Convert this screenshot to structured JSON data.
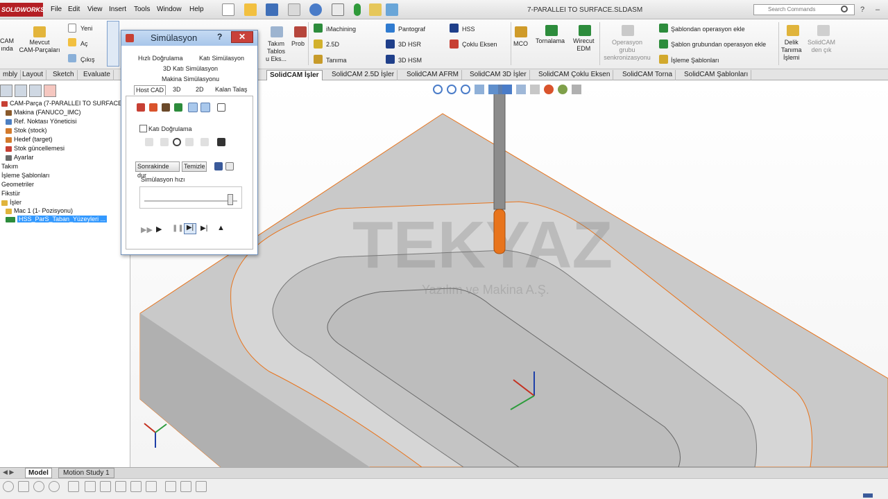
{
  "app": {
    "logo": "SOLIDWORKS",
    "document_title": "7-PARALLEI TO SURFACE.SLDASM",
    "search_placeholder": "Search Commands",
    "colors": {
      "accent": "#b41f24",
      "selection": "#3399ff",
      "tool_tip": "#e8741c"
    }
  },
  "menu": [
    "File",
    "Edit",
    "View",
    "Insert",
    "Tools",
    "Window",
    "Help"
  ],
  "ribbon": {
    "buttons": [
      {
        "label": "CAM\nında"
      },
      {
        "label": "Mevcut\nCAM-Parçaları"
      },
      {
        "label": "Yeni"
      },
      {
        "label": "Aç"
      },
      {
        "label": "Çıkış"
      },
      {
        "label": "Takım\nTablos\nu Eks..."
      },
      {
        "label": "Prob"
      },
      {
        "label": "iMachining"
      },
      {
        "label": "2.5D"
      },
      {
        "label": "Tanıma"
      },
      {
        "label": "Pantograf"
      },
      {
        "label": "3D HSR"
      },
      {
        "label": "3D HSM"
      },
      {
        "label": "HSS"
      },
      {
        "label": "Çoklu Eksen"
      },
      {
        "label": "MCO"
      },
      {
        "label": "Tornalama"
      },
      {
        "label": "Wirecut\nEDM"
      },
      {
        "label": "Operasyon\ngrubu\nsenkronizasyonu"
      },
      {
        "label": "Şablondan operasyon ekle"
      },
      {
        "label": "Şablon grubundan operasyon ekle"
      },
      {
        "label": "İşleme Şablonları"
      },
      {
        "label": "Delik\nTanıma\nİşlemi"
      },
      {
        "label": "SolidCAM\nden çık"
      }
    ]
  },
  "tabs": [
    "mbly",
    "Layout",
    "Sketch",
    "Evaluate",
    "SolidCAM İşler",
    "SolidCAM 2.5D İşler",
    "SolidCAM AFRM",
    "SolidCAM 3D İşler",
    "SolidCAM Çoklu Eksen",
    "SolidCAM Torna",
    "SolidCAM Şablonları"
  ],
  "active_tab": "SolidCAM İşler",
  "tree": [
    "CAM-Parça (7-PARALLEI TO SURFACE)",
    "Makina (FANUCO_IMC)",
    "Ref. Noktası Yöneticisi",
    "Stok (stock)",
    "Hedef (target)",
    "Stok güncellemesi",
    "Ayarlar",
    "Takım",
    "İşleme Şablonları",
    "Geometriler",
    "Fikstür",
    "İşler",
    "Mac 1 (1- Pozisyonu)",
    "HSS_ParS_Taban_Yüzeyleri ..."
  ],
  "dialog": {
    "title": "Simülasyon",
    "help": "?",
    "close": "✕",
    "tabs_row1": [
      "Hızlı Doğrulama",
      "Katı Simülasyon"
    ],
    "tabs_row2": [
      "3D Katı Simülasyon"
    ],
    "tabs_row3": [
      "Makina Simülasyonu"
    ],
    "tabs_row4": [
      "Host CAD",
      "3D",
      "2D",
      "Kalan Talaş"
    ],
    "check_label": "Katı Doğrulama",
    "btn_stop_after": "Sonrakinde dur",
    "btn_clear": "Temizle",
    "speed_label": "Simülasyon hızı",
    "speed_value": 0.95
  },
  "viewport": {
    "watermark": "TEKYAZ",
    "watermark_sub": "Yazılım ve Makina A.Ş."
  },
  "bottom_tabs": [
    "Model",
    "Motion Study 1"
  ]
}
